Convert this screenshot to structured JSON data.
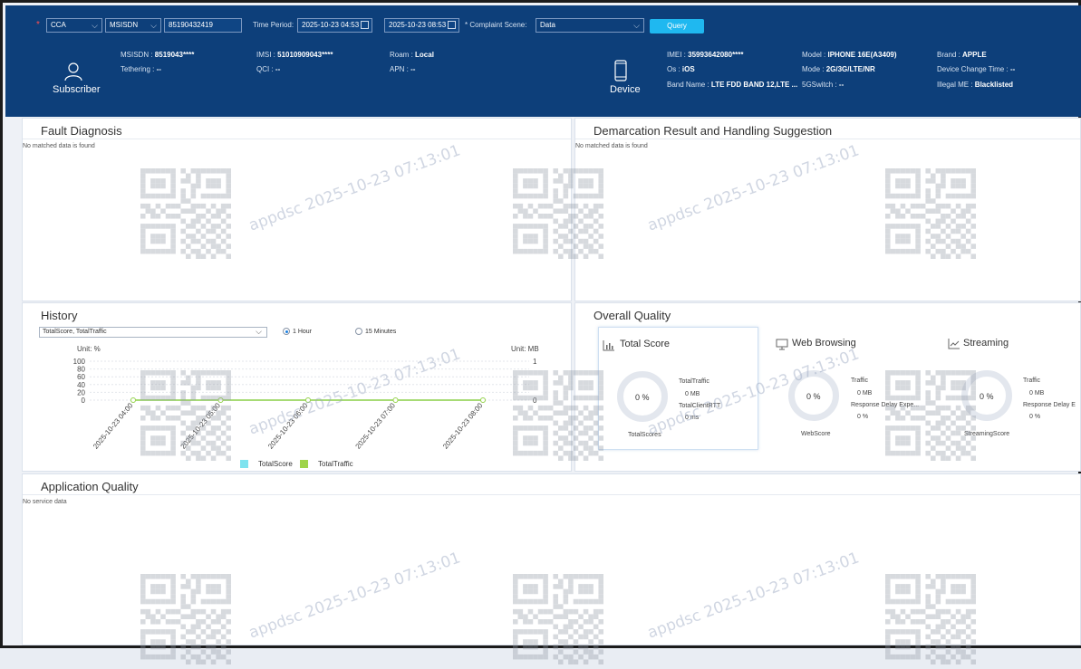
{
  "header": {
    "required_mark": "*",
    "region_select": "CCA",
    "id_type_select": "MSISDN",
    "id_value": "85190432419",
    "time_period_label": "Time Period:",
    "start_time": "2025-10-23 04:53",
    "end_time": "2025-10-23 08:53",
    "complaint_scene_label": "* Complaint Scene:",
    "complaint_scene_value": "Data",
    "query_label": "Query"
  },
  "subscriber": {
    "label": "Subscriber",
    "fields": [
      {
        "key": "MSISDN",
        "value": "8519043****"
      },
      {
        "key": "Tethering",
        "value": "--"
      },
      {
        "key": "IMSI",
        "value": "51010909043****"
      },
      {
        "key": "QCI",
        "value": "--"
      },
      {
        "key": "Roam",
        "value": "Local"
      },
      {
        "key": "APN",
        "value": "--"
      }
    ]
  },
  "device": {
    "label": "Device",
    "fields": [
      {
        "key": "IMEI",
        "value": "35993642080****"
      },
      {
        "key": "Os",
        "value": "iOS"
      },
      {
        "key": "Band Name",
        "value": "LTE FDD BAND 12,LTE ..."
      },
      {
        "key": "Model",
        "value": "IPHONE 16E(A3409)"
      },
      {
        "key": "Mode",
        "value": "2G/3G/LTE/NR"
      },
      {
        "key": "5GSwitch",
        "value": "--"
      },
      {
        "key": "Brand",
        "value": "APPLE"
      },
      {
        "key": "Device Change Time",
        "value": "--"
      },
      {
        "key": "Illegal ME",
        "value": "Blacklisted"
      }
    ]
  },
  "fault_diagnosis": {
    "title": "Fault Diagnosis",
    "empty": "No matched data is found"
  },
  "demarcation": {
    "title": "Demarcation Result and Handling Suggestion",
    "empty": "No matched data is found"
  },
  "history": {
    "title": "History",
    "metric_select": "TotalScore, TotalTraffic",
    "radio_1h": "1 Hour",
    "radio_15m": "15 Minutes",
    "selected_granularity": "1 Hour"
  },
  "chart_data": {
    "type": "line",
    "x": [
      "2025-10-23 04:00",
      "2025-10-23 05:00",
      "2025-10-23 06:00",
      "2025-10-23 07:00",
      "2025-10-23 08:00"
    ],
    "series": [
      {
        "name": "TotalScore",
        "axis": "left",
        "color": "#7fe3ef",
        "values": [
          0,
          0,
          0,
          0,
          0
        ]
      },
      {
        "name": "TotalTraffic",
        "axis": "right",
        "color": "#9fd44a",
        "values": [
          0,
          0,
          0,
          0,
          0
        ]
      }
    ],
    "left_axis": {
      "unit": "Unit: %",
      "ticks": [
        100,
        80,
        60,
        40,
        20,
        0
      ],
      "ylim": [
        0,
        100
      ]
    },
    "right_axis": {
      "unit": "Unit: MB",
      "ticks": [
        1,
        0
      ],
      "ylim": [
        0,
        1
      ]
    },
    "grid": true,
    "legend_placement": "bottom"
  },
  "overall_quality": {
    "title": "Overall Quality",
    "cards": [
      {
        "title": "Total Score",
        "icon": "bar-chart-icon",
        "ring_value": "0 %",
        "score_label": "TotalScores",
        "metrics": [
          {
            "label": "TotalTraffic",
            "value": "0 MB"
          },
          {
            "label": "TotalClientRTT",
            "value": "0 ms"
          }
        ]
      },
      {
        "title": "Web Browsing",
        "icon": "monitor-icon",
        "ring_value": "0 %",
        "score_label": "WebScore",
        "metrics": [
          {
            "label": "Traffic",
            "value": "0 MB"
          },
          {
            "label": "Response Delay Expe...",
            "value": "0 %"
          }
        ]
      },
      {
        "title": "Streaming",
        "icon": "line-chart-icon",
        "ring_value": "0 %",
        "score_label": "StreamingScore",
        "metrics": [
          {
            "label": "Traffic",
            "value": "0 MB"
          },
          {
            "label": "Response Delay E",
            "value": "0 %"
          }
        ]
      }
    ]
  },
  "application_quality": {
    "title": "Application Quality",
    "empty": "No service data"
  },
  "watermark": {
    "text": "appdsc 2025-10-23 07:13:01"
  },
  "colors": {
    "header_bg": "#0d3f7a",
    "query_button": "#1fb8f0",
    "score_series": "#7fe3ef",
    "traffic_series": "#9fd44a"
  }
}
